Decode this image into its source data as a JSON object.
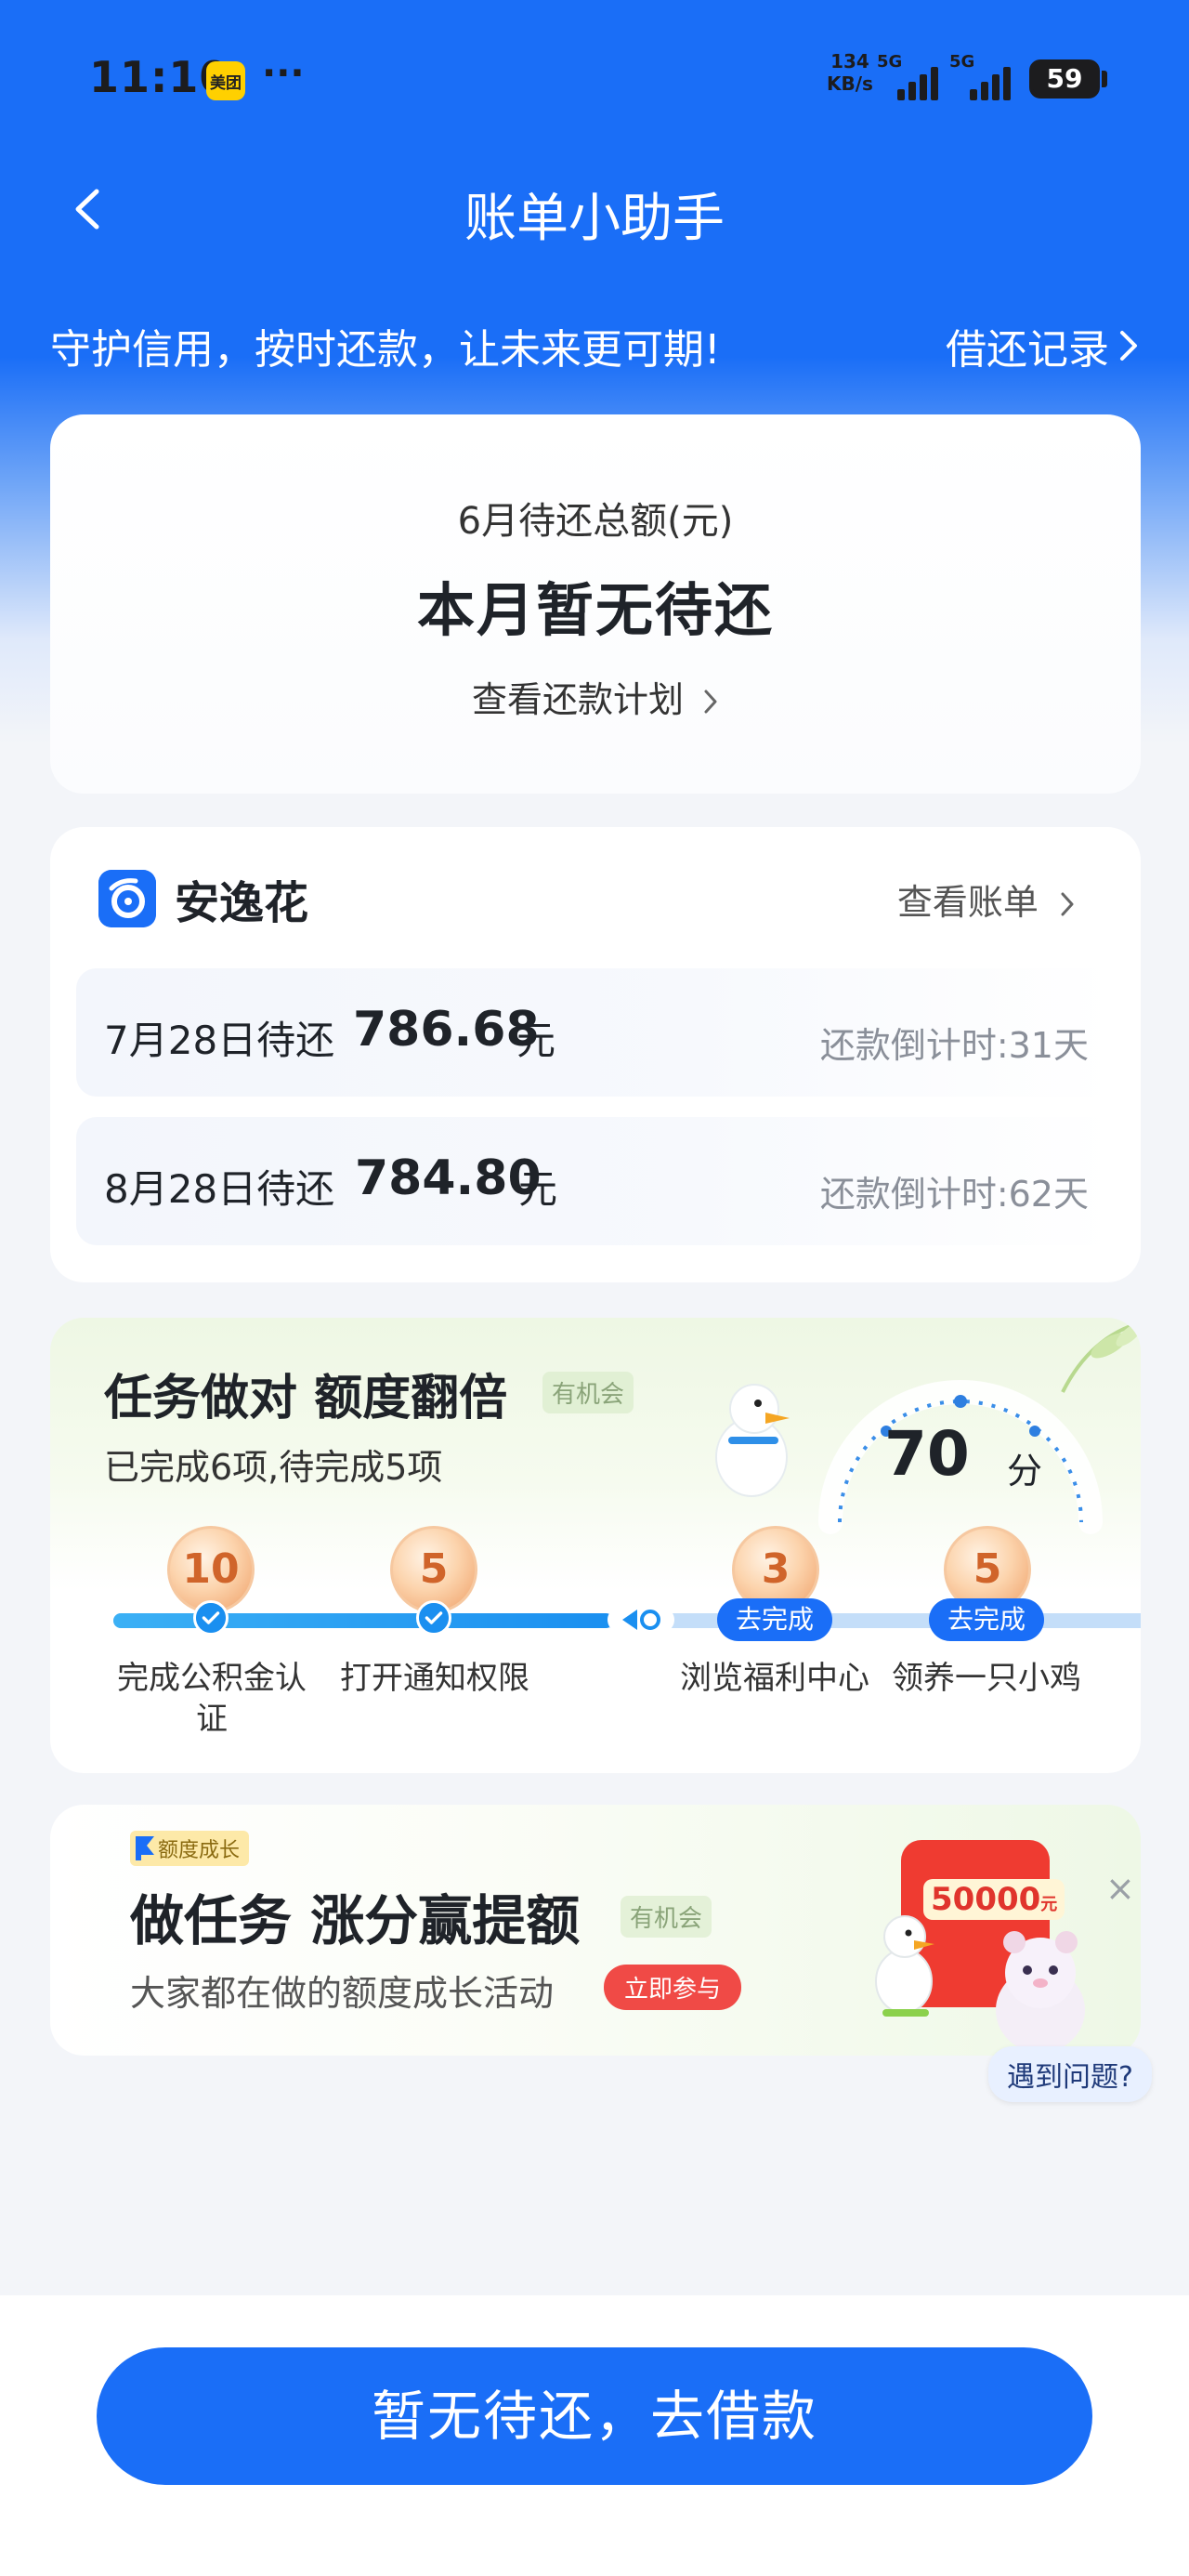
{
  "status_bar": {
    "time": "11:10",
    "app_badge": "美团",
    "more": "···",
    "net_speed_value": "134",
    "net_speed_unit": "KB/s",
    "signal_1": "5G",
    "signal_2": "5G",
    "battery": "59"
  },
  "nav": {
    "title": "账单小助手",
    "back_icon": "chevron-left-icon"
  },
  "hero": {
    "slogan": "守护信用，按时还款，让未来更可期!",
    "history_link": "借还记录"
  },
  "summary": {
    "label": "6月待还总额(元)",
    "value": "本月暂无待还",
    "plan_link": "查看还款计划"
  },
  "anyihua": {
    "brand": "安逸花",
    "view_bill": "查看账单",
    "bills": [
      {
        "date": "7月28日待还",
        "amount": "786.68",
        "unit": "元",
        "countdown": "还款倒计时:31天"
      },
      {
        "date": "8月28日待还",
        "amount": "784.80",
        "unit": "元",
        "countdown": "还款倒计时:62天"
      }
    ]
  },
  "tasks": {
    "title": "任务做对 额度翻倍",
    "chance": "有机会",
    "subtitle": "已完成6项,待完成5项",
    "score": "70",
    "score_unit": "分",
    "progress": 0.48,
    "items": [
      {
        "points": "10",
        "label": "完成公积金认证",
        "status": "done"
      },
      {
        "points": "5",
        "label": "打开通知权限",
        "status": "done"
      },
      {
        "points": "3",
        "label": "浏览福利中心",
        "status": "todo",
        "action": "去完成"
      },
      {
        "points": "5",
        "label": "领养一只小鸡",
        "status": "todo",
        "action": "去完成"
      }
    ]
  },
  "promo": {
    "tag": "额度成长",
    "title": "做任务 涨分赢提额",
    "chance": "有机会",
    "subtitle": "大家都在做的额度成长活动",
    "join": "立即参与",
    "envelope_amount": "50000",
    "envelope_unit": "元",
    "close": "×"
  },
  "help": {
    "bubble": "遇到问题?"
  },
  "footer": {
    "button": "暂无待还，去借款"
  },
  "colors": {
    "brand_blue": "#1a6ef7",
    "progress_blue": "#1a8ff0",
    "join_red": "#f04a46",
    "coin_orange": "#f1a873"
  }
}
